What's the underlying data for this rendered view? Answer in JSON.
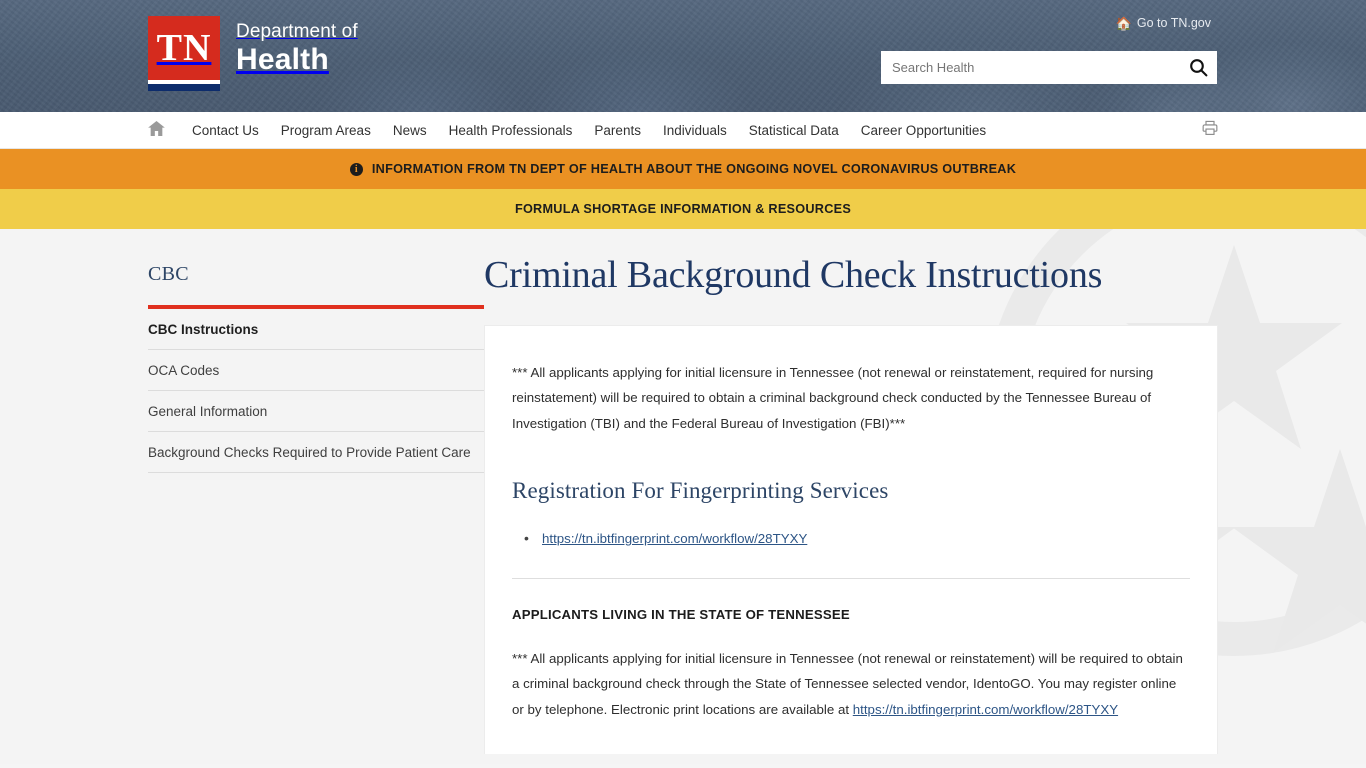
{
  "header": {
    "logo": {
      "mark": "TN",
      "line1": "Department of",
      "line2": "Health"
    },
    "gov_link": {
      "label": "Go to TN.gov",
      "icon": "home-icon"
    },
    "search": {
      "placeholder": "Search Health",
      "value": "",
      "icon": "search-icon"
    },
    "colors": {
      "header_bg": "#4e6077",
      "logo_red": "#d52b1e",
      "logo_blue": "#0d2c6c"
    }
  },
  "nav": {
    "home_icon": "home-icon",
    "print_icon": "printer-icon",
    "items": [
      {
        "label": "Contact Us"
      },
      {
        "label": "Program Areas"
      },
      {
        "label": "News"
      },
      {
        "label": "Health Professionals"
      },
      {
        "label": "Parents"
      },
      {
        "label": "Individuals"
      },
      {
        "label": "Statistical Data"
      },
      {
        "label": "Career Opportunities"
      }
    ]
  },
  "alerts": [
    {
      "text": "INFORMATION FROM TN DEPT OF HEALTH ABOUT THE ONGOING NOVEL CORONAVIRUS OUTBREAK",
      "icon": "info-icon",
      "bg": "#ea9123"
    },
    {
      "text": "FORMULA SHORTAGE INFORMATION & RESOURCES",
      "icon": "",
      "bg": "#f0cd49"
    }
  ],
  "sidebar": {
    "title": "CBC",
    "accent": "#e0301e",
    "items": [
      {
        "label": "CBC Instructions",
        "active": true
      },
      {
        "label": "OCA Codes",
        "active": false
      },
      {
        "label": "General Information",
        "active": false
      },
      {
        "label": "Background Checks Required to Provide Patient Care",
        "active": false
      }
    ]
  },
  "main": {
    "title": "Criminal Background Check Instructions",
    "intro": "*** All applicants applying for initial licensure in Tennessee (not renewal or reinstatement, required for nursing reinstatement) will be required to obtain a criminal background check conducted by the Tennessee Bureau of Investigation (TBI) and the Federal Bureau of Investigation (FBI)***",
    "section_heading": "Registration For Fingerprinting Services",
    "registration_link": "https://tn.ibtfingerprint.com/workflow/28TYXY",
    "subheading": "APPLICANTS LIVING IN THE STATE OF TENNESSEE",
    "paragraph_2": "*** All applicants applying for initial licensure in Tennessee (not renewal or reinstatement) will be required to obtain a criminal background check through the State of Tennessee selected vendor, IdentoGO.   You may register online or by telephone.  Electronic print locations are available at",
    "paragraph_2_link": "https://tn.ibtfingerprint.com/workflow/28TYXY"
  }
}
